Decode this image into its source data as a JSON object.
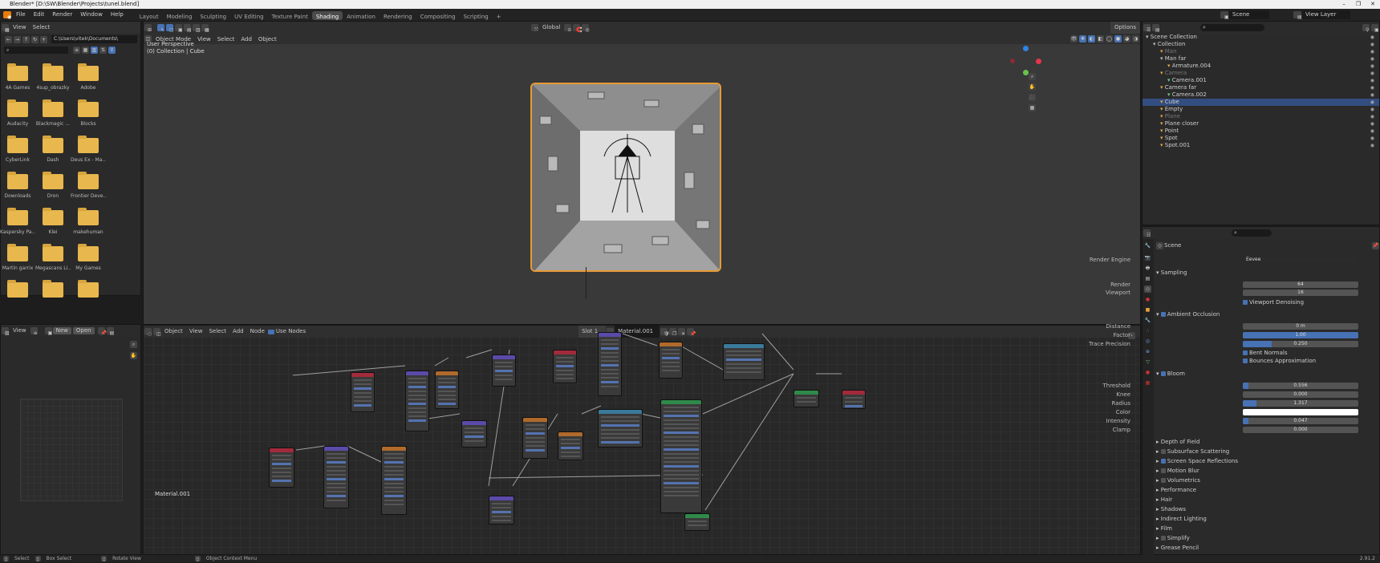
{
  "titlebar": {
    "title": "Blender* [D:\\SW\\Blender\\Projects\\tunel.blend]",
    "min": "–",
    "max": "❐",
    "close": "✕"
  },
  "menu": [
    "File",
    "Edit",
    "Render",
    "Window",
    "Help"
  ],
  "workspaces": [
    "Layout",
    "Modeling",
    "Sculpting",
    "UV Editing",
    "Texture Paint",
    "Shading",
    "Animation",
    "Rendering",
    "Compositing",
    "Scripting",
    "+"
  ],
  "active_workspace": "Shading",
  "topright": {
    "scene": "Scene",
    "view_layer": "View Layer"
  },
  "filebrowser": {
    "menu": [
      "View",
      "Select"
    ],
    "path": "C:\\Users\\vitek\\Documents\\",
    "folders": [
      "4A Games",
      "4sup_obrazky",
      "Adobe",
      "Audacity",
      "Blackmagic ...",
      "Blocks",
      "CyberLink",
      "Dash",
      "Deus Ex - Ma...",
      "Downloads",
      "Dron",
      "Frontier Deve...",
      "Kaspersky Pa...",
      "Klei",
      "makehuman",
      "Martin garrix",
      "Megascans Li...",
      "My Games",
      "",
      "",
      ""
    ]
  },
  "viewport": {
    "mode": "Object Mode",
    "menu": [
      "View",
      "Select",
      "Add",
      "Object"
    ],
    "orientation": "Global",
    "options": "Options",
    "info1": "User Perspective",
    "info2": "(0) Collection | Cube"
  },
  "image_editor": {
    "view": "View",
    "new": "New",
    "open": "Open"
  },
  "node_editor": {
    "mode": "Object",
    "menu": [
      "View",
      "Select",
      "Add",
      "Node"
    ],
    "use_nodes": "Use Nodes",
    "slot": "Slot 1",
    "material": "Material.001",
    "footer_label": "Material.001"
  },
  "outliner": {
    "items": [
      {
        "label": "Scene Collection",
        "indent": 0,
        "dim": false,
        "selected": false,
        "color": "#bbb"
      },
      {
        "label": "Collection",
        "indent": 1,
        "dim": false,
        "selected": false,
        "color": "#bbb"
      },
      {
        "label": "Man",
        "indent": 2,
        "dim": true,
        "selected": false,
        "color": "#e3a14b"
      },
      {
        "label": "Man far",
        "indent": 2,
        "dim": false,
        "selected": false,
        "color": "#bbb"
      },
      {
        "label": "Armature.004",
        "indent": 3,
        "dim": false,
        "selected": false,
        "color": "#e3a14b"
      },
      {
        "label": "Camera",
        "indent": 2,
        "dim": true,
        "selected": false,
        "color": "#e3a14b"
      },
      {
        "label": "Camera.001",
        "indent": 3,
        "dim": false,
        "selected": false,
        "color": "#6ccf88"
      },
      {
        "label": "Camera far",
        "indent": 2,
        "dim": false,
        "selected": false,
        "color": "#e3a14b"
      },
      {
        "label": "Camera.002",
        "indent": 3,
        "dim": false,
        "selected": false,
        "color": "#6ccf88"
      },
      {
        "label": "Cube",
        "indent": 2,
        "dim": false,
        "selected": true,
        "color": "#e3a14b"
      },
      {
        "label": "Empty",
        "indent": 2,
        "dim": false,
        "selected": false,
        "color": "#e3a14b"
      },
      {
        "label": "Plane",
        "indent": 2,
        "dim": true,
        "selected": false,
        "color": "#e3a14b"
      },
      {
        "label": "Plane closer",
        "indent": 2,
        "dim": false,
        "selected": false,
        "color": "#e3a14b"
      },
      {
        "label": "Point",
        "indent": 2,
        "dim": false,
        "selected": false,
        "color": "#e3a14b"
      },
      {
        "label": "Spot",
        "indent": 2,
        "dim": false,
        "selected": false,
        "color": "#e3a14b"
      },
      {
        "label": "Spot.001",
        "indent": 2,
        "dim": false,
        "selected": false,
        "color": "#e3a14b"
      }
    ]
  },
  "properties": {
    "scene": "Scene",
    "render_engine_label": "Render Engine",
    "render_engine": "Eevee",
    "sampling": "Sampling",
    "render_label": "Render",
    "render": "64",
    "viewport_label": "Viewport",
    "viewport": "16",
    "viewport_denoising": "Viewport Denoising",
    "ao": "Ambient Occlusion",
    "distance_label": "Distance",
    "distance": "0 m",
    "factor_label": "Factor",
    "factor": "1.00",
    "factor_fill": 1.0,
    "trace_label": "Trace Precision",
    "trace": "0.250",
    "trace_fill": 0.25,
    "bent_normals": "Bent Normals",
    "bounces": "Bounces Approximation",
    "bloom": "Bloom",
    "threshold_label": "Threshold",
    "threshold": "0.556",
    "threshold_fill": 0.05,
    "knee_label": "Knee",
    "knee": "0.000",
    "radius_label": "Radius",
    "radius": "1.317",
    "radius_fill": 0.12,
    "color_label": "Color",
    "intensity_label": "Intensity",
    "intensity": "0.047",
    "intensity_fill": 0.05,
    "clamp_label": "Clamp",
    "clamp": "0.000",
    "sections": [
      "Depth of Field",
      "Subsurface Scattering",
      "Screen Space Reflections",
      "Motion Blur",
      "Volumetrics",
      "Performance",
      "Hair",
      "Shadows",
      "Indirect Lighting",
      "Film",
      "Simplify",
      "Grease Pencil"
    ]
  },
  "statusbar": {
    "select": "Select",
    "box": "Box Select",
    "rotate": "Rotate View",
    "context": "Object Context Menu",
    "version": "2.91.2"
  }
}
